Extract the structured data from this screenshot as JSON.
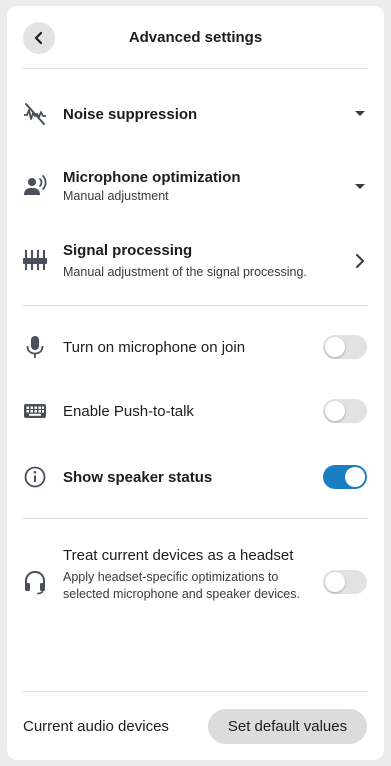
{
  "header": {
    "title": "Advanced settings",
    "back_icon": "chevron-left-icon"
  },
  "audio": {
    "noise": {
      "label": "Noise suppression",
      "icon": "noise-suppression-icon",
      "caret": "chevron-down-icon"
    },
    "mic_opt": {
      "label": "Microphone optimization",
      "sub": "Manual adjustment",
      "icon": "speaking-person-icon",
      "caret": "chevron-down-icon"
    },
    "signal": {
      "label": "Signal processing",
      "sub": "Manual adjustment of the signal processing.",
      "icon": "equalizer-icon",
      "caret": "chevron-right-icon"
    }
  },
  "toggles": {
    "mic_join": {
      "label": "Turn on microphone on join",
      "on": false,
      "icon": "microphone-icon"
    },
    "ptt": {
      "label": "Enable Push-to-talk",
      "on": false,
      "icon": "keyboard-icon"
    },
    "speaker_status": {
      "label": "Show speaker status",
      "on": true,
      "icon": "info-icon"
    },
    "headset": {
      "label": "Treat current devices as a headset",
      "sub": "Apply headset-specific optimizations to selected microphone and speaker devices.",
      "on": false,
      "icon": "headset-icon"
    }
  },
  "footer": {
    "devices_label": "Current audio devices",
    "default_button": "Set default values"
  },
  "colors": {
    "toggle_on": "#1a7fc2",
    "toggle_off": "#e2e2e2",
    "icon": "#4a4f5c"
  }
}
